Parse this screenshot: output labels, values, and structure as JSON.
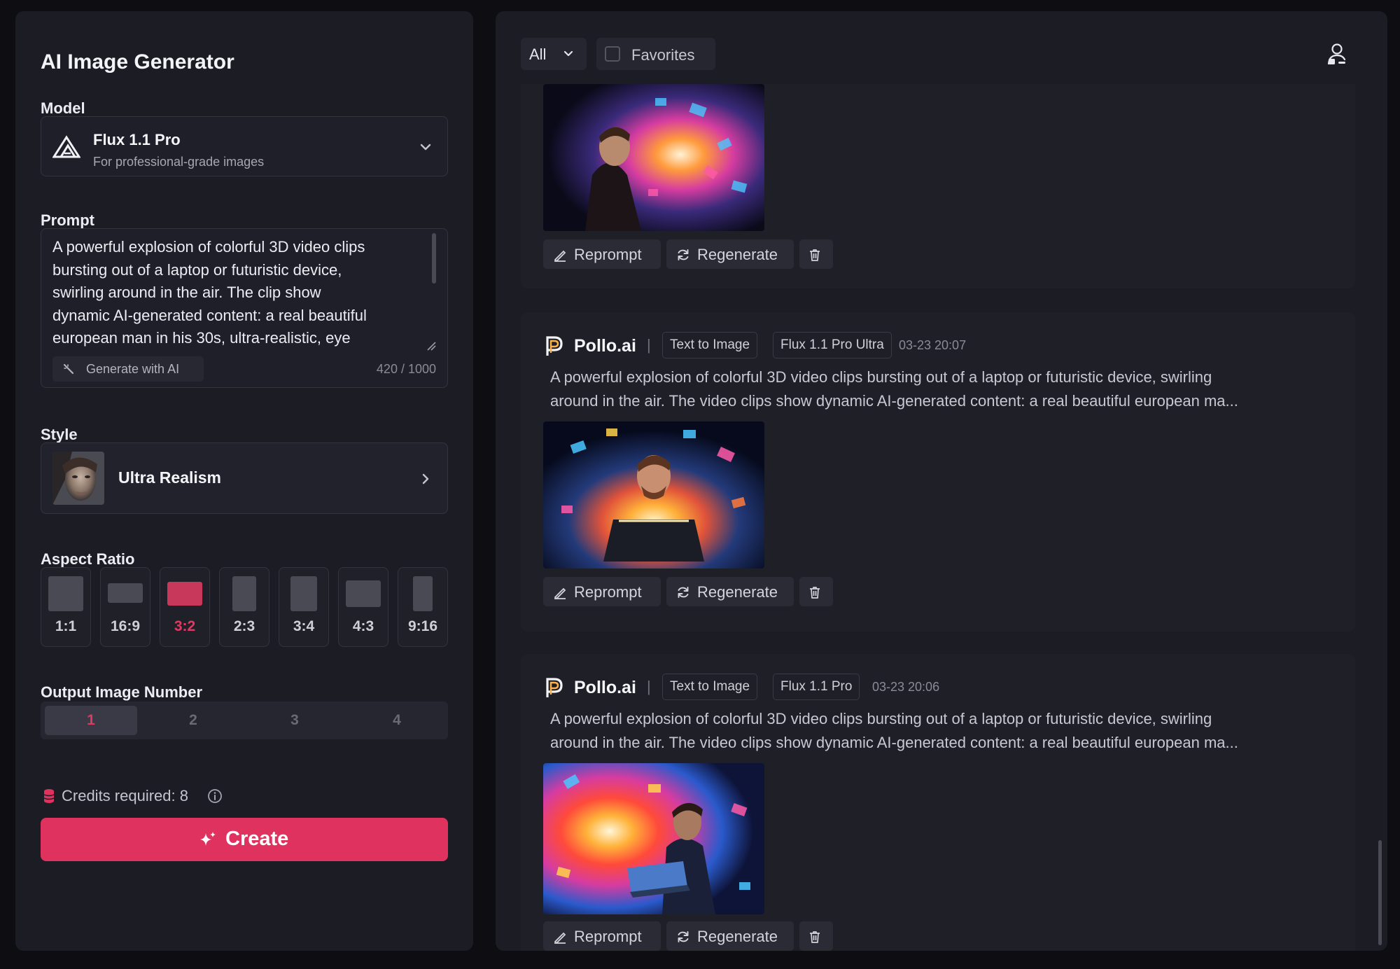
{
  "app": {
    "title": "AI Image Generator"
  },
  "model": {
    "label": "Model",
    "name": "Flux 1.1 Pro",
    "description": "For professional-grade images"
  },
  "prompt": {
    "label": "Prompt",
    "value": "A powerful explosion of colorful 3D video clips\nbursting out of a laptop or futuristic device,\nswirling around in the air. The clip show\ndynamic AI-generated content: a real beautiful\neuropean man in his 30s, ultra-realistic, eye",
    "generate_label": "Generate with AI",
    "char_count": "420 / 1000"
  },
  "style": {
    "label": "Style",
    "name": "Ultra Realism"
  },
  "aspect_ratio": {
    "label": "Aspect Ratio",
    "options": [
      "1:1",
      "16:9",
      "3:2",
      "2:3",
      "3:4",
      "4:3",
      "9:16"
    ],
    "selected": "3:2"
  },
  "output_number": {
    "label": "Output Image Number",
    "options": [
      "1",
      "2",
      "3",
      "4"
    ],
    "selected": "1"
  },
  "credits": {
    "text": "Credits required: 8"
  },
  "create": {
    "label": "Create"
  },
  "filters": {
    "all_label": "All",
    "favorites_label": "Favorites"
  },
  "actions": {
    "reprompt": "Reprompt",
    "regenerate": "Regenerate"
  },
  "feed": [
    {
      "brand": "Pollo.ai",
      "mode": "Text to Image",
      "model": "Flux 1.1 Pro Ultra",
      "time": "03-23 20:07",
      "prompt_line1": "A powerful explosion of colorful 3D video clips bursting out of a laptop or futuristic device, swirling",
      "prompt_line2": "around in the air. The video clips show dynamic AI-generated content: a real beautiful european ma..."
    },
    {
      "brand": "Pollo.ai",
      "mode": "Text to Image",
      "model": "Flux 1.1 Pro",
      "time": "03-23 20:06",
      "prompt_line1": "A powerful explosion of colorful 3D video clips bursting out of a laptop or futuristic device, swirling",
      "prompt_line2": "around in the air. The video clips show dynamic AI-generated content: a real beautiful european ma..."
    }
  ],
  "colors": {
    "accent": "#e0325e",
    "panel": "#1c1c25",
    "background": "#0d0d12"
  }
}
